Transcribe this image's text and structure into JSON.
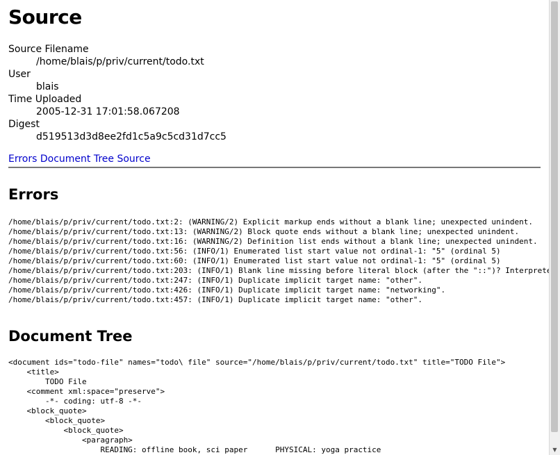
{
  "page_title": "Source",
  "metadata": [
    {
      "term": "Source Filename",
      "value": "/home/blais/p/priv/current/todo.txt"
    },
    {
      "term": "User",
      "value": "blais"
    },
    {
      "term": "Time Uploaded",
      "value": "2005-12-31 17:01:58.067208"
    },
    {
      "term": "Digest",
      "value": "d519513d3d8ee2fd1c5a9c5cd31d7cc5"
    }
  ],
  "nav_links": [
    "Errors",
    "Document Tree",
    "Source"
  ],
  "errors": {
    "title": "Errors",
    "lines": [
      "/home/blais/p/priv/current/todo.txt:2: (WARNING/2) Explicit markup ends without a blank line; unexpected unindent.",
      "/home/blais/p/priv/current/todo.txt:13: (WARNING/2) Block quote ends without a blank line; unexpected unindent.",
      "/home/blais/p/priv/current/todo.txt:16: (WARNING/2) Definition list ends without a blank line; unexpected unindent.",
      "/home/blais/p/priv/current/todo.txt:56: (INFO/1) Enumerated list start value not ordinal-1: \"5\" (ordinal 5)",
      "/home/blais/p/priv/current/todo.txt:60: (INFO/1) Enumerated list start value not ordinal-1: \"5\" (ordinal 5)",
      "/home/blais/p/priv/current/todo.txt:203: (INFO/1) Blank line missing before literal block (after the \"::\")? Interpreted as a definition list item.",
      "/home/blais/p/priv/current/todo.txt:247: (INFO/1) Duplicate implicit target name: \"other\".",
      "/home/blais/p/priv/current/todo.txt:426: (INFO/1) Duplicate implicit target name: \"networking\".",
      "/home/blais/p/priv/current/todo.txt:457: (INFO/1) Duplicate implicit target name: \"other\"."
    ]
  },
  "document_tree": {
    "title": "Document Tree",
    "lines": [
      "<document ids=\"todo-file\" names=\"todo\\ file\" source=\"/home/blais/p/priv/current/todo.txt\" title=\"TODO File\">",
      "    <title>",
      "        TODO File",
      "    <comment xml:space=\"preserve\">",
      "        -*- coding: utf-8 -*-",
      "    <block_quote>",
      "        <block_quote>",
      "            <block_quote>",
      "                <paragraph>",
      "                    READING: offline book, sci paper      PHYSICAL: yoga practice"
    ]
  }
}
